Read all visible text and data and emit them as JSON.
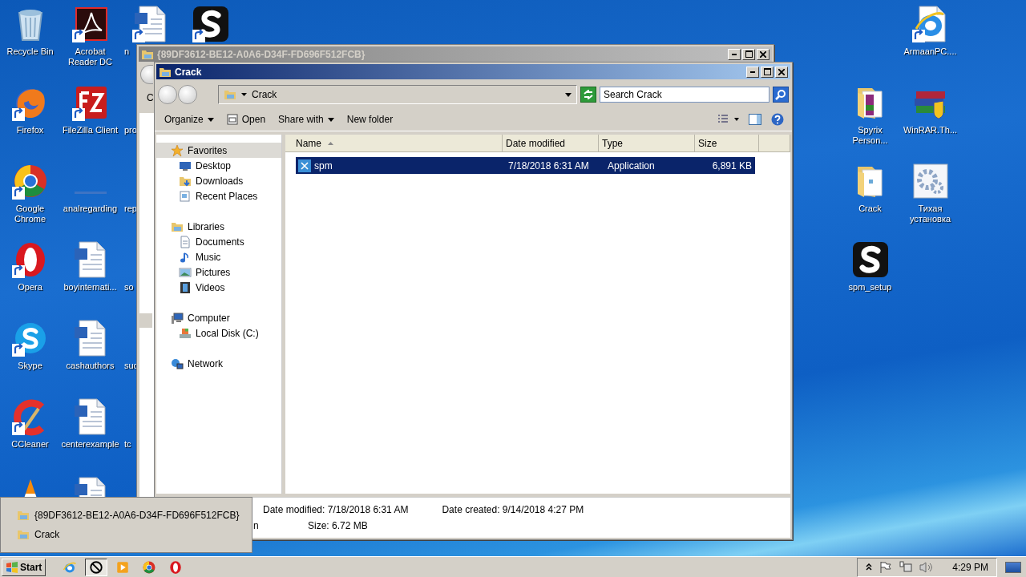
{
  "desktop_left_columns": [
    [
      {
        "kind": "recycle",
        "shortcut": false,
        "label": "Recycle Bin"
      },
      {
        "kind": "firefox",
        "shortcut": true,
        "label": "Firefox"
      },
      {
        "kind": "chrome",
        "shortcut": true,
        "label": "Google Chrome"
      },
      {
        "kind": "opera",
        "shortcut": true,
        "label": "Opera"
      },
      {
        "kind": "skype",
        "shortcut": true,
        "label": "Skype"
      },
      {
        "kind": "ccleaner",
        "shortcut": true,
        "label": "CCleaner"
      },
      {
        "kind": "vlc"
      }
    ],
    [
      {
        "kind": "acrobat",
        "shortcut": true,
        "label": "Acrobat Reader DC"
      },
      {
        "kind": "filezilla",
        "shortcut": true,
        "label": "FileZilla Client"
      },
      {
        "kind": "blank",
        "label": "analregarding"
      },
      {
        "kind": "word",
        "shortcut": false,
        "label": "boyinternati..."
      },
      {
        "kind": "word",
        "shortcut": false,
        "label": "cashauthors"
      },
      {
        "kind": "word",
        "shortcut": false,
        "label": "centerexample"
      },
      {
        "kind": "word"
      }
    ],
    [
      {
        "kind": "word",
        "shortcut": true,
        "label": "n"
      },
      {
        "label": "pro"
      },
      {
        "label": "rep"
      },
      {
        "label": "so"
      },
      {
        "label": "suc"
      },
      {
        "label": "tc"
      }
    ],
    [
      {
        "kind": "s-app",
        "shortcut": true
      }
    ]
  ],
  "desktop_right_columns": [
    [
      null,
      {
        "kind": "zip-folder",
        "shortcut": false,
        "label": "Spyrix Person..."
      },
      {
        "kind": "folder",
        "shortcut": false,
        "label": "Crack"
      },
      {
        "kind": "s-app",
        "shortcut": false,
        "label": "spm_setup"
      }
    ],
    [
      {
        "kind": "ie-doc",
        "shortcut": true,
        "label": "ArmaanPC...."
      },
      {
        "kind": "winrar",
        "shortcut": false,
        "label": "WinRAR.Th..."
      },
      {
        "kind": "settings",
        "shortcut": false,
        "label": "Тихая установка"
      }
    ]
  ],
  "back_window": {
    "title": "{89DF3612-BE12-A0A6-D34F-FD696F512FCB}",
    "toolbar_text": "C"
  },
  "window": {
    "title": "Crack",
    "address": "Crack",
    "search_placeholder": "Search Crack",
    "toolbar": [
      {
        "label": "Organize",
        "kind": "menu"
      },
      {
        "label": "Open",
        "kind": "open"
      },
      {
        "label": "Share with",
        "kind": "menu"
      },
      {
        "label": "New folder",
        "kind": "plain"
      }
    ],
    "nav": [
      {
        "label": "Favorites",
        "kind": "star",
        "selected": true,
        "children": [
          {
            "label": "Desktop",
            "kind": "desktop",
            "selected": false
          },
          {
            "label": "Downloads",
            "kind": "downloads",
            "selected": false
          },
          {
            "label": "Recent Places",
            "kind": "recent",
            "selected": false
          }
        ]
      },
      {
        "label": "Libraries",
        "kind": "libraries",
        "selected": false,
        "children": [
          {
            "label": "Documents",
            "kind": "documents",
            "selected": false
          },
          {
            "label": "Music",
            "kind": "music",
            "selected": false
          },
          {
            "label": "Pictures",
            "kind": "pictures",
            "selected": false
          },
          {
            "label": "Videos",
            "kind": "videos",
            "selected": false
          }
        ]
      },
      {
        "label": "Computer",
        "kind": "computer",
        "selected": false,
        "children": [
          {
            "label": "Local Disk (C:)",
            "kind": "disk",
            "selected": false
          }
        ]
      },
      {
        "label": "Network",
        "kind": "network",
        "selected": false
      }
    ],
    "columns": [
      {
        "label": "Name",
        "sorted": true
      },
      {
        "label": "Date modified",
        "sorted": false
      },
      {
        "label": "Type",
        "sorted": false
      },
      {
        "label": "Size",
        "sorted": false
      }
    ],
    "rows": [
      {
        "name": "spm",
        "date_modified": "7/18/2018 6:31 AM",
        "type": "Application",
        "size": "6,891 KB",
        "selected": true
      }
    ],
    "details": [
      {
        "label": "Date modified:",
        "value": "7/18/2018 6:31 AM"
      },
      {
        "label": "Date created:",
        "value": "9/14/2018 4:27 PM"
      }
    ],
    "details_second_line": [
      {
        "text": "n"
      },
      {
        "label": "Size:",
        "value": "6.72 MB"
      }
    ]
  },
  "jump_list": [
    {
      "label": "{89DF3612-BE12-A0A6-D34F-FD696F512FCB}"
    },
    {
      "label": "Crack"
    }
  ],
  "taskbar": {
    "start": "Start",
    "apps": [
      {
        "kind": "ie",
        "active": false
      },
      {
        "kind": "nosign",
        "active": true
      },
      {
        "kind": "media",
        "active": false
      },
      {
        "kind": "chrome",
        "active": false
      },
      {
        "kind": "opera",
        "active": false
      }
    ],
    "clock": "4:29 PM"
  }
}
